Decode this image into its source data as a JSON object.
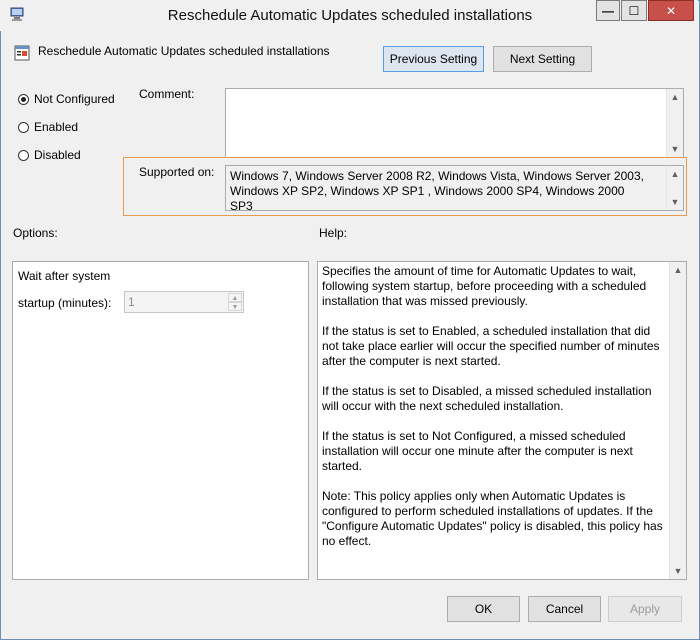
{
  "window": {
    "title": "Reschedule Automatic Updates scheduled installations",
    "minimize_glyph": "—",
    "maximize_glyph": "☐",
    "close_glyph": "✕"
  },
  "header": {
    "title": "Reschedule Automatic Updates scheduled installations",
    "previous_label": "Previous Setting",
    "next_label": "Next Setting"
  },
  "state": {
    "options": [
      {
        "label": "Not Configured",
        "selected": true
      },
      {
        "label": "Enabled",
        "selected": false
      },
      {
        "label": "Disabled",
        "selected": false
      }
    ]
  },
  "comment": {
    "label": "Comment:",
    "value": ""
  },
  "supported": {
    "label": "Supported on:",
    "value": "Windows 7, Windows Server 2008 R2, Windows Vista, Windows Server 2003, Windows XP SP2, Windows XP SP1 , Windows 2000 SP4, Windows 2000 SP3"
  },
  "options_panel": {
    "heading": "Options:",
    "line1": "Wait after system",
    "field_label": "startup (minutes):",
    "field_value": "1"
  },
  "help_panel": {
    "heading": "Help:",
    "paragraphs": [
      "Specifies the amount of time for Automatic Updates to wait, following system startup, before proceeding with a scheduled installation that was missed previously.",
      "If the status is set to Enabled, a scheduled installation that did not take place earlier will occur the specified number of minutes after the computer is next started.",
      "If the status is set to Disabled, a missed scheduled installation will occur with the next scheduled installation.",
      "If the status is set to Not Configured, a missed scheduled installation will occur one minute after the computer is next started.",
      "Note: This policy applies only when Automatic Updates is configured to perform scheduled installations of updates. If the \"Configure Automatic Updates\" policy is disabled, this policy has no effect."
    ]
  },
  "footer": {
    "ok_label": "OK",
    "cancel_label": "Cancel",
    "apply_label": "Apply"
  },
  "icons": {
    "window": "policy-window-icon",
    "header": "policy-setting-icon",
    "scroll_up": "scroll-up-arrow-icon",
    "scroll_down": "scroll-down-arrow-icon"
  },
  "colors": {
    "window_border": "#6b8fb8",
    "close_button": "#c7504a",
    "supported_highlight": "#e89a52",
    "focus_border": "#569de5"
  }
}
